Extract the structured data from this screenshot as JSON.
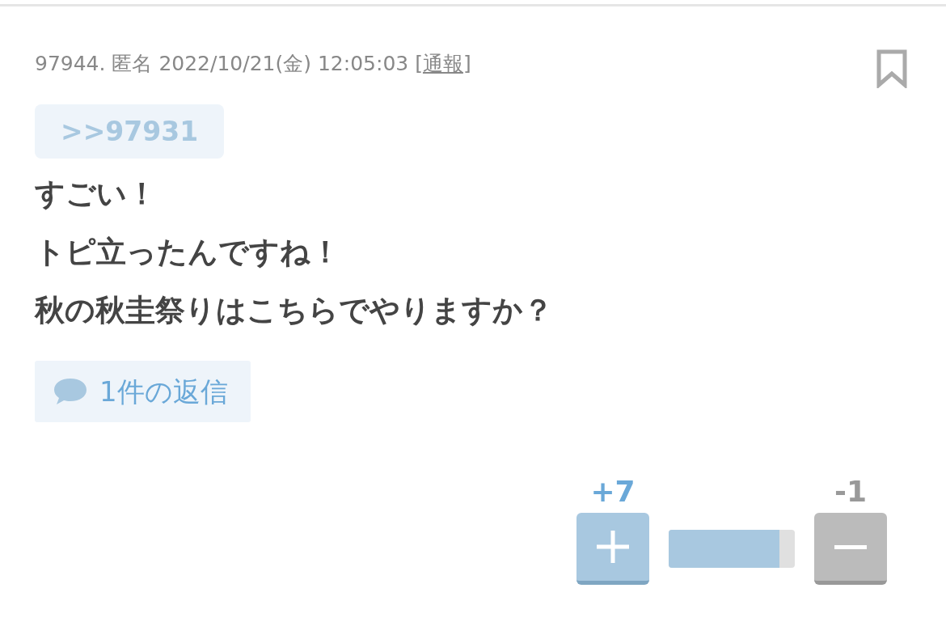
{
  "post": {
    "number": "97944.",
    "author": "匿名",
    "datetime": "2022/10/21(金) 12:05:03",
    "report_open": "[",
    "report_link": "通報",
    "report_close": "]",
    "bookmarked": false,
    "anchor": ">>97931",
    "lines": [
      "すごい！",
      "トピ立ったんですね！",
      "秋の秋圭祭りはこちらでやりますか？"
    ],
    "replies": "1件の返信",
    "votes": {
      "plus": "+7",
      "minus": "-1",
      "level": 0.875
    }
  }
}
